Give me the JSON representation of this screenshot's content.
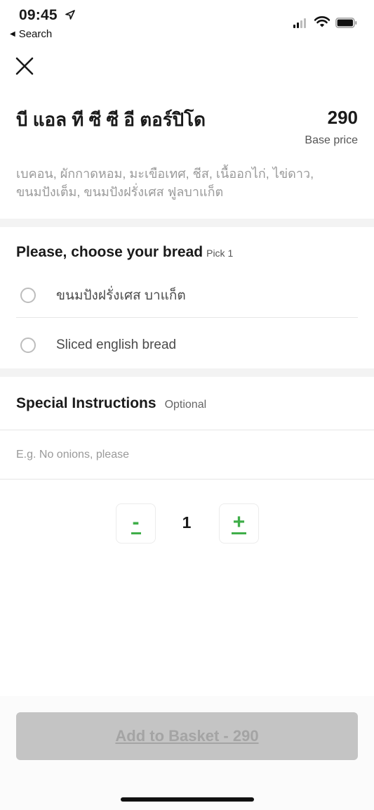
{
  "status_bar": {
    "time": "09:45",
    "back_label": "Search",
    "icons": [
      "location-arrow-icon",
      "signal-icon",
      "wifi-icon",
      "battery-icon"
    ]
  },
  "header": {
    "close_icon": "close-icon",
    "title": "บี แอล ที ซี ซี อี ตอร์ปิโด",
    "price": "290",
    "price_caption": "Base price",
    "description": "เบคอน, ผักกาดหอม, มะเขือเทศ, ชีส, เนื้ออกไก่, ไข่ดาว, ขนมปังเต็ม, ขนมปังฝรั่งเศส ฟูลบาแก็ต"
  },
  "bread_section": {
    "heading": "Please, choose your bread",
    "hint": "Pick 1",
    "options": [
      {
        "label": "ขนมปังฝรั่งเศส บาแก็ต",
        "selected": false
      },
      {
        "label": "Sliced english bread",
        "selected": false
      }
    ]
  },
  "instructions": {
    "heading": "Special Instructions",
    "hint": "Optional",
    "placeholder": "E.g. No onions, please",
    "value": ""
  },
  "quantity": {
    "decrement_label": "-",
    "value": "1",
    "increment_label": "+"
  },
  "footer": {
    "add_button_label": "Add to Basket - 290"
  },
  "colors": {
    "accent_green": "#3fae49",
    "disabled_button": "#c4c4c4",
    "muted_text": "#9a9a9a"
  }
}
